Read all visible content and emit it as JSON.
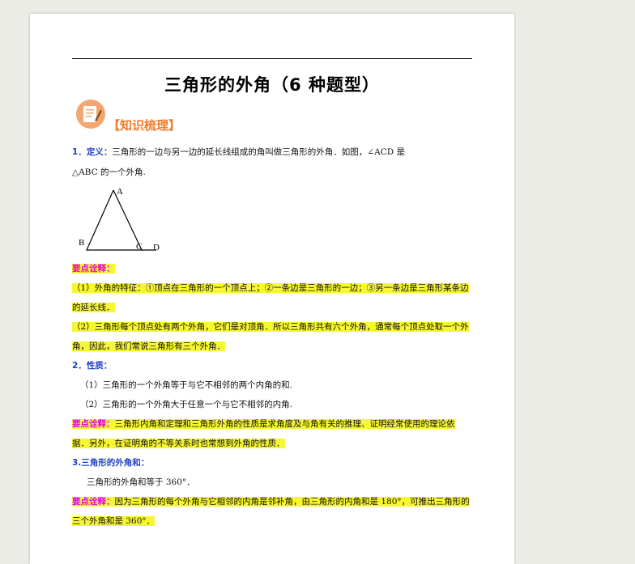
{
  "title": "三角形的外角（6 种题型）",
  "section_heading": "【知识梳理】",
  "def": {
    "num": "1．",
    "label": "定义",
    "colon": "：",
    "text_1": "三角形的一边与另一边的延长线组成的角叫做三角形的外角．如图，∠ACD 是",
    "text_2": "△ABC 的一个外角."
  },
  "figure": {
    "label_a": "A",
    "label_b": "B",
    "label_c": "C",
    "label_d": "D"
  },
  "note1": {
    "label": "要点诠释：",
    "line_1": "（1）外角的特征：①顶点在三角形的一个顶点上；②一条边是三角形的一边；③另一条边是三角形某条边",
    "line_2": "的延长线．",
    "line_3": "（2）三角形每个顶点处有两个外角，它们是对顶角．所以三角形共有六个外角，通常每个顶点处取一个外",
    "line_4": "角，因此，我们常说三角形有三个外角．"
  },
  "prop": {
    "num": "2．",
    "label": "性质：",
    "item_1": "（1）三角形的一个外角等于与它不相邻的两个内角的和.",
    "item_2": "（2）三角形的一个外角大于任意一个与它不相邻的内角."
  },
  "note2": {
    "label": "要点诠释：",
    "line_1": "三角形内角和定理和三角形外角的性质是求角度及与角有关的推理、证明经常使用的理论依",
    "line_2": "据．另外，在证明角的不等关系时也常想到外角的性质．"
  },
  "sum": {
    "heading": "3.三角形的外角和：",
    "text": "三角形的外角和等于 360°．"
  },
  "note3": {
    "label": "要点诠释：",
    "line_1": "因为三角形的每个外角与它相邻的内角是邻补角，由三角形的内角和是 180°，可推出三角形的",
    "line_2": "三个外角和是 360°．"
  }
}
